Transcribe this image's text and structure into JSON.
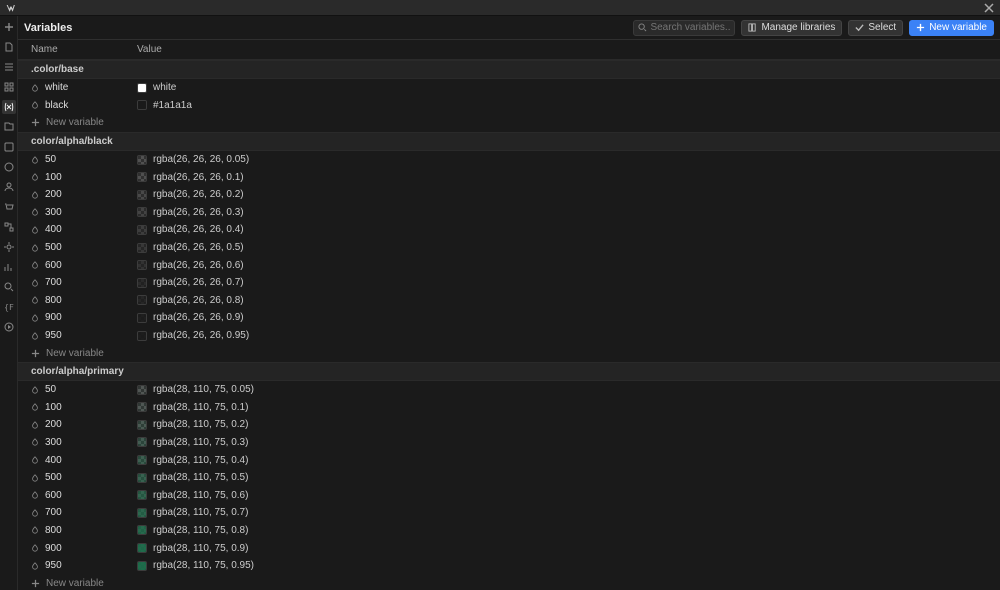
{
  "header": {
    "title": "Variables",
    "search_placeholder": "Search variables...",
    "manage_label": "Manage libraries",
    "select_label": "Select",
    "new_label": "New variable"
  },
  "columns": {
    "name": "Name",
    "value": "Value"
  },
  "new_variable_label": "New variable",
  "groups": [
    {
      "name": ".color/base",
      "vars": [
        {
          "name": "white",
          "value_text": "white",
          "color": "#ffffff",
          "alpha": 1
        },
        {
          "name": "black",
          "value_text": "#1a1a1a",
          "color": "#1a1a1a",
          "alpha": 1
        }
      ]
    },
    {
      "name": "color/alpha/black",
      "vars": [
        {
          "name": "50",
          "value_text": "rgba(26, 26, 26, 0.05)",
          "color": "#1a1a1a",
          "alpha": 0.05
        },
        {
          "name": "100",
          "value_text": "rgba(26, 26, 26, 0.1)",
          "color": "#1a1a1a",
          "alpha": 0.1
        },
        {
          "name": "200",
          "value_text": "rgba(26, 26, 26, 0.2)",
          "color": "#1a1a1a",
          "alpha": 0.2
        },
        {
          "name": "300",
          "value_text": "rgba(26, 26, 26, 0.3)",
          "color": "#1a1a1a",
          "alpha": 0.3
        },
        {
          "name": "400",
          "value_text": "rgba(26, 26, 26, 0.4)",
          "color": "#1a1a1a",
          "alpha": 0.4
        },
        {
          "name": "500",
          "value_text": "rgba(26, 26, 26, 0.5)",
          "color": "#1a1a1a",
          "alpha": 0.5
        },
        {
          "name": "600",
          "value_text": "rgba(26, 26, 26, 0.6)",
          "color": "#1a1a1a",
          "alpha": 0.6
        },
        {
          "name": "700",
          "value_text": "rgba(26, 26, 26, 0.7)",
          "color": "#1a1a1a",
          "alpha": 0.7
        },
        {
          "name": "800",
          "value_text": "rgba(26, 26, 26, 0.8)",
          "color": "#1a1a1a",
          "alpha": 0.8
        },
        {
          "name": "900",
          "value_text": "rgba(26, 26, 26, 0.9)",
          "color": "#1a1a1a",
          "alpha": 0.9
        },
        {
          "name": "950",
          "value_text": "rgba(26, 26, 26, 0.95)",
          "color": "#1a1a1a",
          "alpha": 0.95
        }
      ]
    },
    {
      "name": "color/alpha/primary",
      "vars": [
        {
          "name": "50",
          "value_text": "rgba(28, 110, 75, 0.05)",
          "color": "#1c6e4b",
          "alpha": 0.05
        },
        {
          "name": "100",
          "value_text": "rgba(28, 110, 75, 0.1)",
          "color": "#1c6e4b",
          "alpha": 0.1
        },
        {
          "name": "200",
          "value_text": "rgba(28, 110, 75, 0.2)",
          "color": "#1c6e4b",
          "alpha": 0.2
        },
        {
          "name": "300",
          "value_text": "rgba(28, 110, 75, 0.3)",
          "color": "#1c6e4b",
          "alpha": 0.3
        },
        {
          "name": "400",
          "value_text": "rgba(28, 110, 75, 0.4)",
          "color": "#1c6e4b",
          "alpha": 0.4
        },
        {
          "name": "500",
          "value_text": "rgba(28, 110, 75, 0.5)",
          "color": "#1c6e4b",
          "alpha": 0.5
        },
        {
          "name": "600",
          "value_text": "rgba(28, 110, 75, 0.6)",
          "color": "#1c6e4b",
          "alpha": 0.6
        },
        {
          "name": "700",
          "value_text": "rgba(28, 110, 75, 0.7)",
          "color": "#1c6e4b",
          "alpha": 0.7
        },
        {
          "name": "800",
          "value_text": "rgba(28, 110, 75, 0.8)",
          "color": "#1c6e4b",
          "alpha": 0.8
        },
        {
          "name": "900",
          "value_text": "rgba(28, 110, 75, 0.9)",
          "color": "#1c6e4b",
          "alpha": 0.9
        },
        {
          "name": "950",
          "value_text": "rgba(28, 110, 75, 0.95)",
          "color": "#1c6e4b",
          "alpha": 0.95
        }
      ]
    }
  ],
  "sidebar_tools": [
    "add",
    "page",
    "navigator",
    "components",
    "variables",
    "assets",
    "cms-icon",
    "app-icon",
    "users-icon",
    "ecommerce-icon",
    "logic-icon",
    "settings-icon",
    "audit-icon",
    "find-icon",
    "help-icon",
    "video-icon"
  ]
}
